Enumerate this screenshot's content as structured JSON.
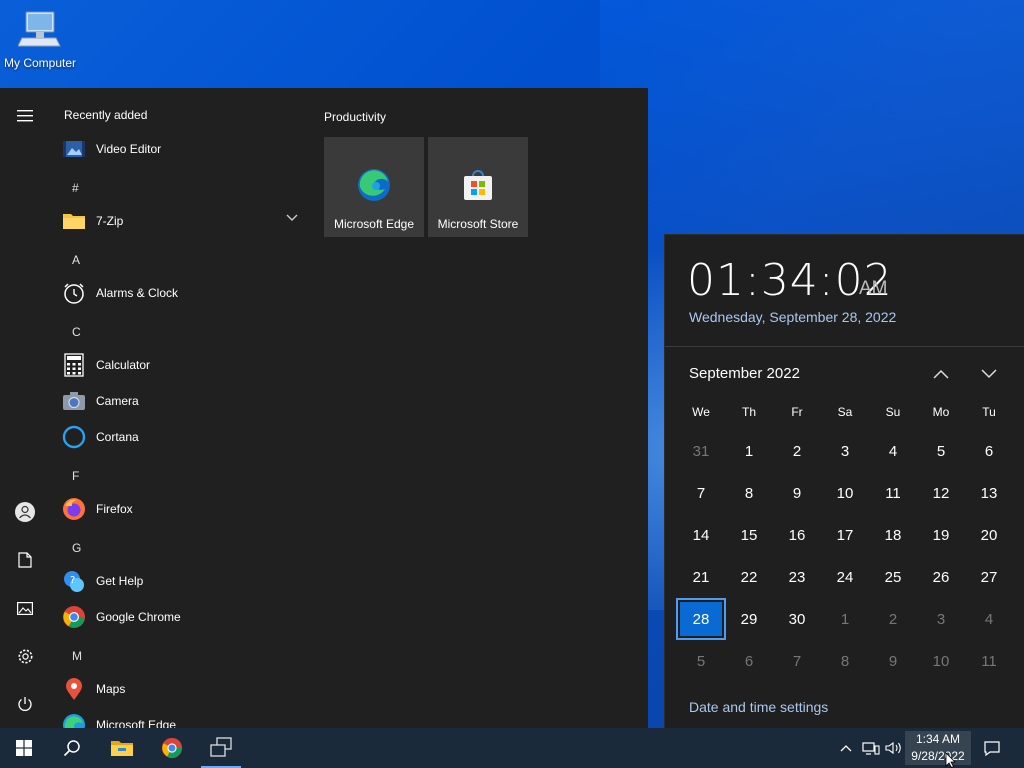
{
  "desktop": {
    "icon_label": "My Computer"
  },
  "start_menu": {
    "recently_added_label": "Recently added",
    "productivity_label": "Productivity",
    "apps": [
      {
        "kind": "app",
        "name": "Video Editor",
        "icon": "video-editor-icon"
      },
      {
        "kind": "letter",
        "name": "#"
      },
      {
        "kind": "app",
        "name": "7-Zip",
        "icon": "folder-icon"
      },
      {
        "kind": "letter",
        "name": "A"
      },
      {
        "kind": "app",
        "name": "Alarms & Clock",
        "icon": "alarm-clock-icon"
      },
      {
        "kind": "letter",
        "name": "C"
      },
      {
        "kind": "app",
        "name": "Calculator",
        "icon": "calculator-icon"
      },
      {
        "kind": "app",
        "name": "Camera",
        "icon": "camera-icon"
      },
      {
        "kind": "app",
        "name": "Cortana",
        "icon": "cortana-icon"
      },
      {
        "kind": "letter",
        "name": "F"
      },
      {
        "kind": "app",
        "name": "Firefox",
        "icon": "firefox-icon"
      },
      {
        "kind": "letter",
        "name": "G"
      },
      {
        "kind": "app",
        "name": "Get Help",
        "icon": "get-help-icon"
      },
      {
        "kind": "app",
        "name": "Google Chrome",
        "icon": "chrome-icon"
      },
      {
        "kind": "letter",
        "name": "M"
      },
      {
        "kind": "app",
        "name": "Maps",
        "icon": "maps-icon"
      },
      {
        "kind": "app",
        "name": "Microsoft Edge",
        "icon": "edge-icon"
      }
    ],
    "tiles": [
      {
        "name": "Microsoft Edge",
        "icon": "edge-icon"
      },
      {
        "name": "Microsoft Store",
        "icon": "store-icon"
      }
    ],
    "rail_icons": [
      "hamburger-menu-icon",
      "user-icon",
      "documents-icon",
      "pictures-icon",
      "settings-gear-icon",
      "power-icon"
    ]
  },
  "clock_flyout": {
    "time": "01:34:02",
    "ampm": "AM",
    "date": "Wednesday, September 28, 2022",
    "month_label": "September 2022",
    "weekdays": [
      "We",
      "Th",
      "Fr",
      "Sa",
      "Su",
      "Mo",
      "Tu"
    ],
    "weeks": [
      [
        "31",
        "1",
        "2",
        "3",
        "4",
        "5",
        "6"
      ],
      [
        "7",
        "8",
        "9",
        "10",
        "11",
        "12",
        "13"
      ],
      [
        "14",
        "15",
        "16",
        "17",
        "18",
        "19",
        "20"
      ],
      [
        "21",
        "22",
        "23",
        "24",
        "25",
        "26",
        "27"
      ],
      [
        "28",
        "29",
        "30",
        "1",
        "2",
        "3",
        "4"
      ],
      [
        "5",
        "6",
        "7",
        "8",
        "9",
        "10",
        "11"
      ]
    ],
    "today": "28",
    "settings_link": "Date and time settings"
  },
  "taskbar": {
    "clock_time": "1:34 AM",
    "clock_date": "9/28/2022",
    "pinned": [
      "start-button",
      "search-icon",
      "file-explorer-icon",
      "chrome-icon",
      "task-view-icon"
    ]
  },
  "colors": {
    "accent": "#0a6ad4",
    "start_bg": "#202020",
    "flyout_bg": "#1f1f1f",
    "taskbar_bg": "#1b2a3a",
    "link": "#a9c8f0"
  }
}
